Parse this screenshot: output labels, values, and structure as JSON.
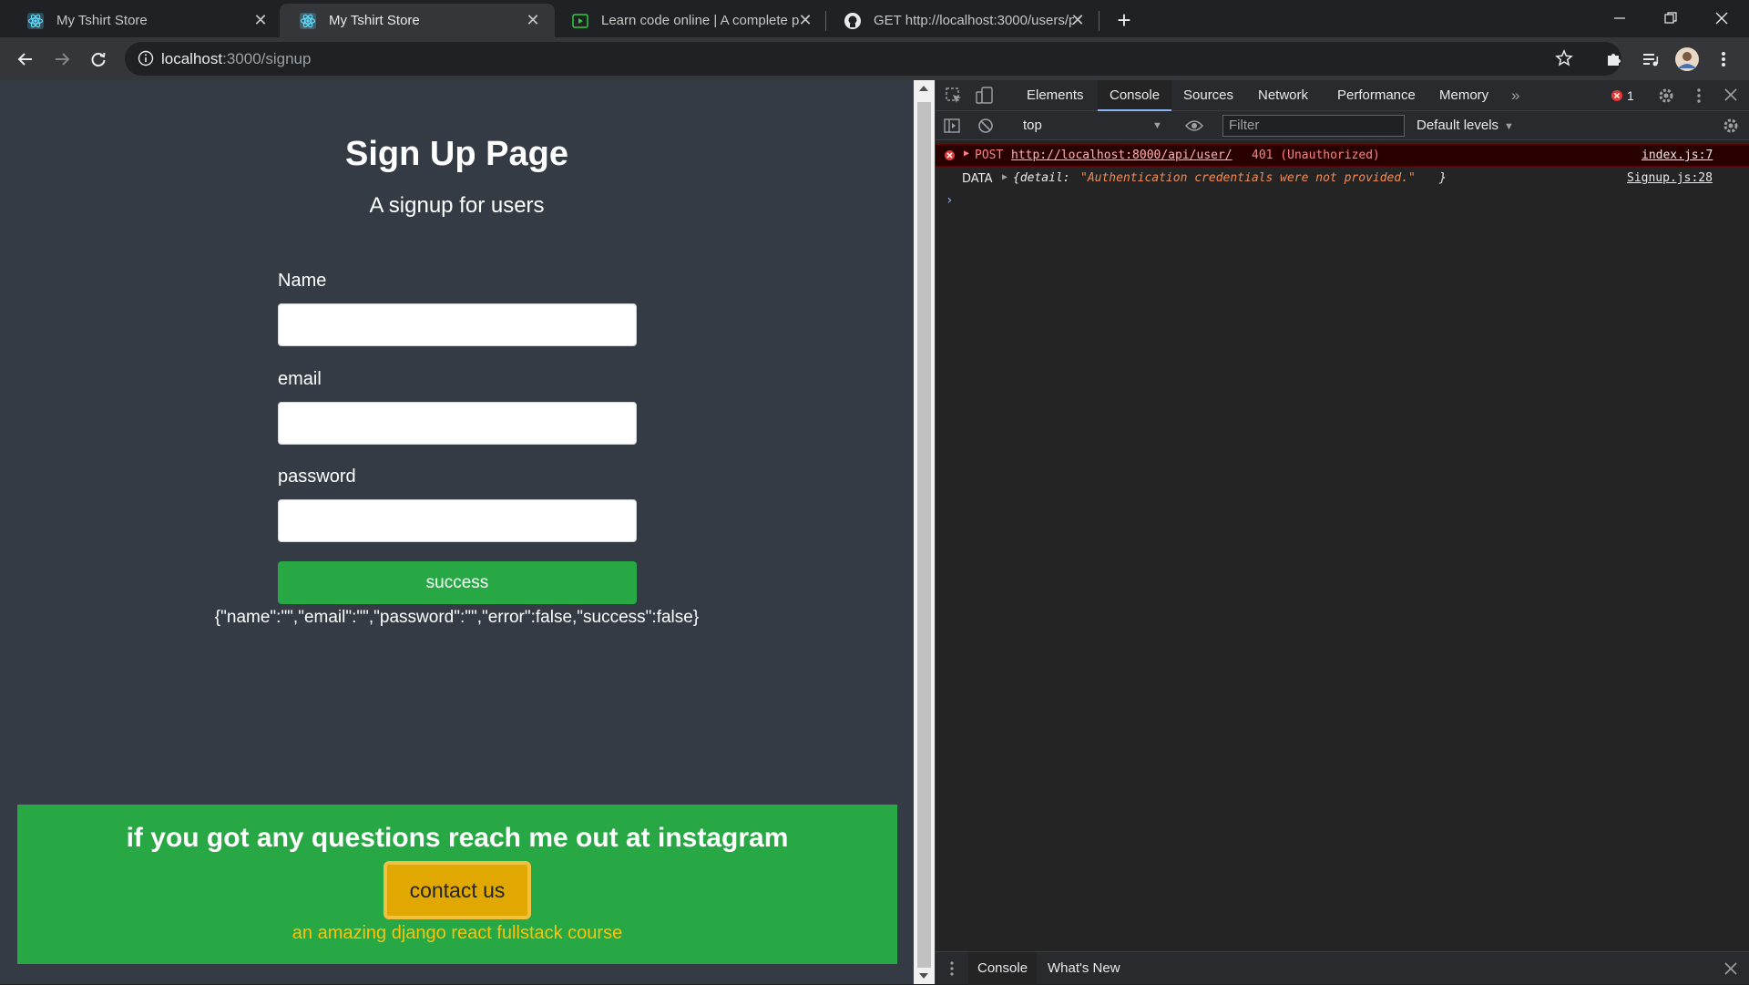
{
  "browser": {
    "tabs": [
      {
        "title": "My Tshirt Store",
        "active": false
      },
      {
        "title": "My Tshirt Store",
        "active": true
      },
      {
        "title": "Learn code online | A complete p",
        "active": false
      },
      {
        "title": "GET http://localhost:3000/users/p",
        "active": false
      }
    ],
    "url_host": "localhost",
    "url_path": ":3000/signup"
  },
  "page": {
    "title": "Sign Up Page",
    "subtitle": "A signup for users",
    "fields": [
      {
        "label": "Name",
        "value": ""
      },
      {
        "label": "email",
        "value": ""
      },
      {
        "label": "password",
        "value": ""
      }
    ],
    "submit_label": "success",
    "state_json": "{\"name\":\"\",\"email\":\"\",\"password\":\"\",\"error\":false,\"success\":false}",
    "footer": {
      "heading": "if you got any questions reach me out at instagram",
      "button": "contact us",
      "subtext": "an amazing django react fullstack course"
    }
  },
  "devtools": {
    "tabs": [
      "Elements",
      "Console",
      "Sources",
      "Network",
      "Performance",
      "Memory"
    ],
    "active_tab": "Console",
    "error_count": "1",
    "context": "top",
    "filter_placeholder": "Filter",
    "levels": "Default levels",
    "console": {
      "error": {
        "method": "POST",
        "url": "http://localhost:8000/api/user/",
        "status": "401 (Unauthorized)",
        "source": "index.js:7"
      },
      "log": {
        "label": "DATA",
        "key": "{detail: ",
        "value": "\"Authentication credentials were not provided.\"",
        "close": "}",
        "source": "Signup.js:28"
      }
    },
    "drawer_tabs": [
      "Console",
      "What's New"
    ]
  },
  "colors": {
    "accent_green": "#28a745",
    "accent_yellow": "#ffc107",
    "page_bg": "#353b45"
  }
}
